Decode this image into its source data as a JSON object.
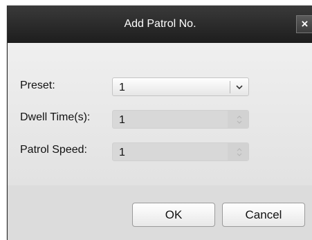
{
  "dialog": {
    "title": "Add Patrol No.",
    "close_label": "×"
  },
  "form": {
    "preset": {
      "label": "Preset:",
      "value": "1"
    },
    "dwell_time": {
      "label": "Dwell Time(s):",
      "value": "1"
    },
    "patrol_speed": {
      "label": "Patrol Speed:",
      "value": "1"
    }
  },
  "buttons": {
    "ok_label": "OK",
    "cancel_label": "Cancel"
  },
  "icons": {
    "close": "close-icon",
    "preset_dropdown": "chevron-down-icon",
    "dwell_stepper": "stepper-icon",
    "speed_stepper": "stepper-icon"
  },
  "colors": {
    "titlebar": "#1e1e1e",
    "dialog_bg": "#e9e9e9",
    "footer_bg": "#dcdcdc"
  }
}
